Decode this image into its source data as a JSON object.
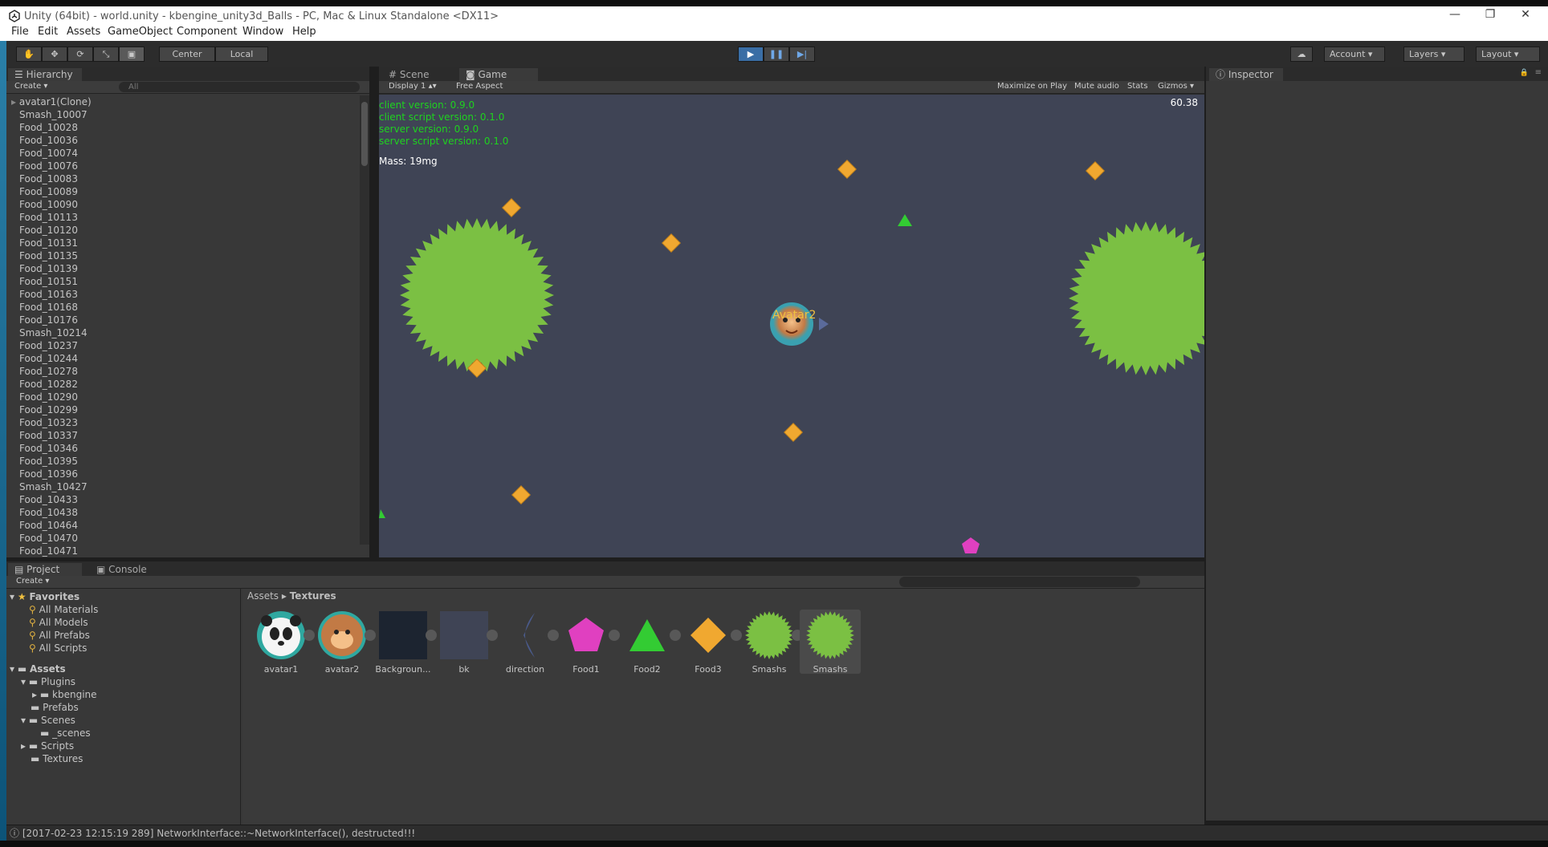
{
  "window": {
    "title": "Unity (64bit) - world.unity - kbengine_unity3d_Balls - PC, Mac & Linux Standalone <DX11>",
    "minimize": "—",
    "restore": "❐",
    "close": "✕"
  },
  "menu": [
    "File",
    "Edit",
    "Assets",
    "GameObject",
    "Component",
    "Window",
    "Help"
  ],
  "toolbar": {
    "pivot": "Center",
    "space": "Local",
    "account": "Account",
    "layers": "Layers",
    "layout": "Layout"
  },
  "hierarchy": {
    "tab": "Hierarchy",
    "create": "Create",
    "search_placeholder": "All",
    "items": [
      "avatar1(Clone)",
      "Smash_10007",
      "Food_10028",
      "Food_10036",
      "Food_10074",
      "Food_10076",
      "Food_10083",
      "Food_10089",
      "Food_10090",
      "Food_10113",
      "Food_10120",
      "Food_10131",
      "Food_10135",
      "Food_10139",
      "Food_10151",
      "Food_10163",
      "Food_10168",
      "Food_10176",
      "Smash_10214",
      "Food_10237",
      "Food_10244",
      "Food_10278",
      "Food_10282",
      "Food_10290",
      "Food_10299",
      "Food_10323",
      "Food_10337",
      "Food_10346",
      "Food_10395",
      "Food_10396",
      "Smash_10427",
      "Food_10433",
      "Food_10438",
      "Food_10464",
      "Food_10470",
      "Food_10471"
    ]
  },
  "game": {
    "tab_scene": "Scene",
    "tab_game": "Game",
    "display": "Display 1",
    "aspect": "Free Aspect",
    "maximize": "Maximize on Play",
    "mute": "Mute audio",
    "stats": "Stats",
    "gizmos": "Gizmos",
    "fps": "60.38",
    "client_version": "client version: 0.9.0",
    "client_script_version": "client script version: 0.1.0",
    "server_version": "server version: 0.9.0",
    "server_script_version": "server script version: 0.1.0",
    "mass": "Mass: 19mg",
    "avatar_label": "Avatar2",
    "colors": {
      "background": "#3f4455",
      "smash": "#7bc043",
      "food_gold": "#f0a830",
      "food_green": "#33cc33",
      "food_pink": "#e040c0",
      "hud_text": "#1fd21f"
    }
  },
  "inspector": {
    "tab": "Inspector"
  },
  "project": {
    "tab_project": "Project",
    "tab_console": "Console",
    "create": "Create",
    "favorites_label": "Favorites",
    "favorites": [
      "All Materials",
      "All Models",
      "All Prefabs",
      "All Scripts"
    ],
    "assets_label": "Assets",
    "folders": [
      "Plugins",
      "kbengine",
      "Prefabs",
      "Scenes",
      "_scenes",
      "Scripts",
      "Textures"
    ],
    "breadcrumb_root": "Assets",
    "breadcrumb_current": "Textures",
    "textures": [
      "avatar1",
      "avatar2",
      "Backgroun...",
      "bk",
      "direction",
      "Food1",
      "Food2",
      "Food3",
      "Smashs",
      "Smashs"
    ]
  },
  "status": {
    "message": "[2017-02-23 12:15:19 289] NetworkInterface::~NetworkInterface(), destructed!!!"
  }
}
